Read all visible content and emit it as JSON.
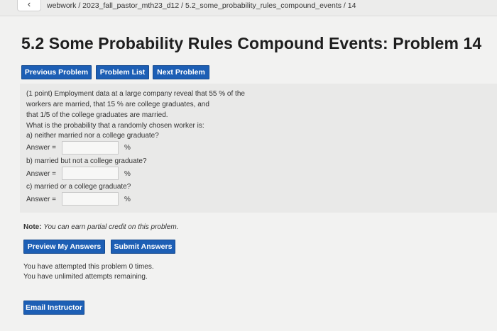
{
  "breadcrumb": "webwork / 2023_fall_pastor_mth23_d12 / 5.2_some_probability_rules_compound_events / 14",
  "title": "5.2 Some Probability Rules Compound Events: Problem 14",
  "nav": {
    "previous": "Previous Problem",
    "list": "Problem List",
    "next": "Next Problem"
  },
  "problem": {
    "line1": "(1 point) Employment data at a large company reveal that 55 % of the",
    "line2": "workers are married, that 15 % are college graduates, and",
    "line3": "that 1/5 of the college graduates are married.",
    "line4": "What is the probability that a randomly chosen worker is:",
    "qa": "a) neither married nor a college graduate?",
    "qb": "b) married but not a college graduate?",
    "qc": "c) married or a college graduate?",
    "answer_label": "Answer =",
    "percent": "%",
    "answers": [
      "",
      "",
      ""
    ]
  },
  "note": {
    "label": "Note:",
    "text": "You can earn partial credit on this problem."
  },
  "actions": {
    "preview": "Preview My Answers",
    "submit": "Submit Answers"
  },
  "attempts": {
    "line1": "You have attempted this problem 0 times.",
    "line2": "You have unlimited attempts remaining."
  },
  "email_instructor": "Email Instructor",
  "colors": {
    "button_blue": "#1d5fb5",
    "page_bg": "#f2f2f1",
    "problem_bg": "#e9e9e8"
  }
}
